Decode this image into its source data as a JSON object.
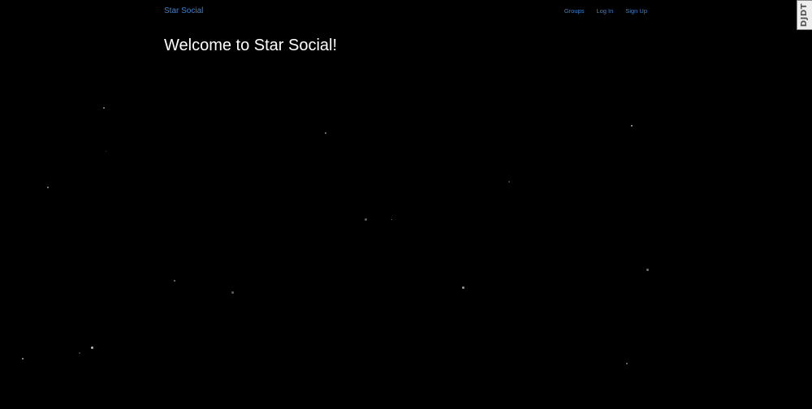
{
  "navbar": {
    "brand": "Star Social",
    "links": [
      "Groups",
      "Log In",
      "Sign Up"
    ]
  },
  "main": {
    "heading": "Welcome to Star Social!"
  },
  "debug_toolbar": {
    "label": "DJDT"
  },
  "colors": {
    "background": "#000000",
    "link": "#3f7fc9",
    "heading": "#ffffff",
    "star": "#bbbbbb"
  }
}
